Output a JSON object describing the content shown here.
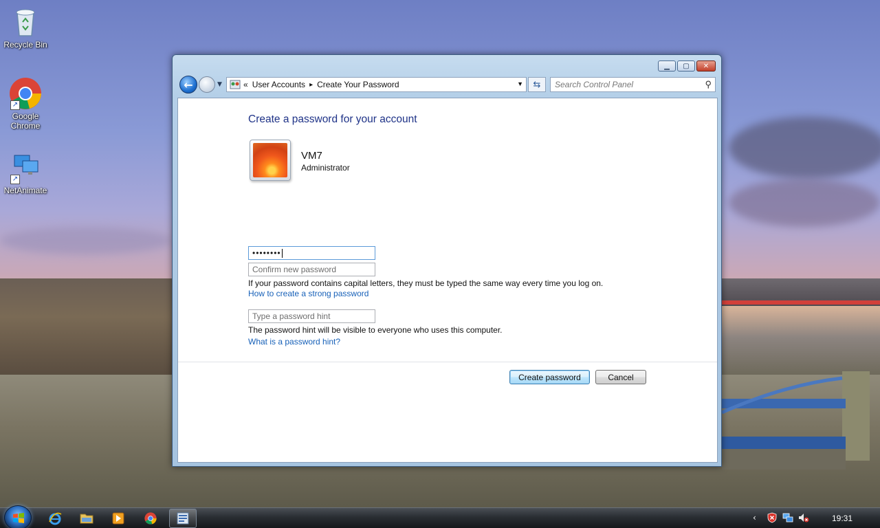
{
  "desktop": {
    "icons": [
      {
        "label": "Recycle Bin",
        "icon": "recycle-bin-icon"
      },
      {
        "label": "Google Chrome",
        "icon": "chrome-icon"
      },
      {
        "label": "NetAnimate",
        "icon": "netanimate-icon"
      }
    ]
  },
  "window": {
    "controls": {
      "minimize": "minimize",
      "maximize": "maximize",
      "close": "close"
    },
    "address": {
      "prefix": "«",
      "crumbs": [
        "User Accounts",
        "Create Your Password"
      ],
      "separator": "▸"
    },
    "search": {
      "placeholder": "Search Control Panel"
    },
    "content": {
      "heading": "Create a password for your account",
      "user": {
        "name": "VM7",
        "role": "Administrator"
      },
      "new_password_value": "••••••••",
      "confirm_placeholder": "Confirm new password",
      "capital_note": "If your password contains capital letters, they must be typed the same way every time you log on.",
      "strong_link": "How to create a strong password",
      "hint_placeholder": "Type a password hint",
      "hint_note": "The password hint will be visible to everyone who uses this computer.",
      "hint_link": "What is a password hint?",
      "create_button": "Create password",
      "cancel_button": "Cancel"
    }
  },
  "taskbar": {
    "pinned": [
      "internet-explorer-icon",
      "explorer-folder-icon",
      "media-player-icon",
      "chrome-icon",
      "control-panel-icon"
    ],
    "tray": [
      "chevron-left-icon",
      "security-alert-icon",
      "network-icon",
      "volume-muted-icon"
    ],
    "clock": "19:31"
  },
  "colors": {
    "heading": "#1e3287",
    "link": "#1660b8",
    "close_button": "#c2402a"
  }
}
